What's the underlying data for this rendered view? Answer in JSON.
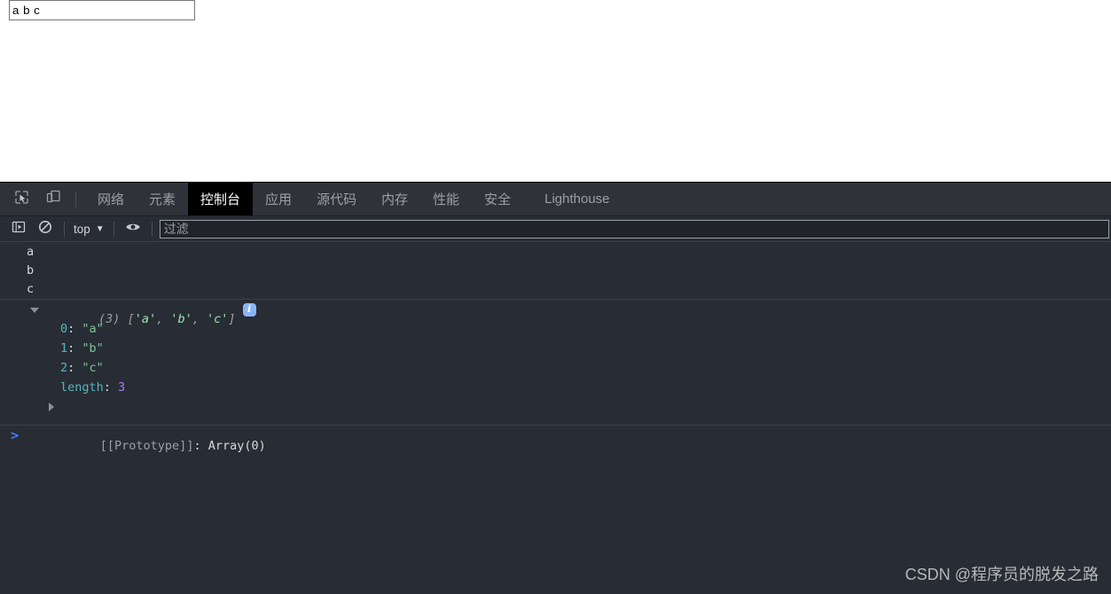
{
  "page": {
    "input_value": "a b c",
    "input_placeholder": ""
  },
  "devtools": {
    "toolbar": {
      "inspect_icon": "inspect-cursor-icon",
      "device_icon": "device-toolbar-icon"
    },
    "tabs": [
      {
        "id": "network",
        "label": "网络",
        "active": false
      },
      {
        "id": "elements",
        "label": "元素",
        "active": false
      },
      {
        "id": "console",
        "label": "控制台",
        "active": true
      },
      {
        "id": "application",
        "label": "应用",
        "active": false
      },
      {
        "id": "sources",
        "label": "源代码",
        "active": false
      },
      {
        "id": "memory",
        "label": "内存",
        "active": false
      },
      {
        "id": "performance",
        "label": "性能",
        "active": false
      },
      {
        "id": "security",
        "label": "安全",
        "active": false
      },
      {
        "id": "lighthouse",
        "label": "Lighthouse",
        "active": false
      }
    ],
    "console_toolbar": {
      "execute_icon": "execute-sidebar-icon",
      "clear_icon": "clear-console-icon",
      "context_label": "top",
      "context_caret": "▼",
      "eye_icon": "live-expression-eye-icon",
      "filter_placeholder": "过滤",
      "filter_value": ""
    },
    "console_output": {
      "log_lines": [
        "a",
        "b",
        "c"
      ],
      "array_entry": {
        "count_label": "(3)",
        "preview": "['a', 'b', 'c']",
        "preview_open": "[",
        "preview_items": [
          "'a'",
          "'b'",
          "'c'"
        ],
        "preview_close": "]",
        "separator": ", ",
        "info_badge": "i",
        "expanded": true,
        "properties": [
          {
            "key": "0",
            "value": "\"a\"",
            "type": "string"
          },
          {
            "key": "1",
            "value": "\"b\"",
            "type": "string"
          },
          {
            "key": "2",
            "value": "\"c\"",
            "type": "string"
          },
          {
            "key": "length",
            "value": "3",
            "type": "number"
          }
        ],
        "prototype": {
          "key": "[[Prototype]]",
          "value": "Array(0)"
        }
      }
    },
    "prompt": {
      "chevron": ">",
      "value": "",
      "placeholder": ""
    }
  },
  "watermark": {
    "text": "CSDN @程序员的脱发之路"
  },
  "colors": {
    "devtools_bg": "#282c34",
    "tabbar_bg": "#2f3238",
    "active_tab_bg": "#000000",
    "accent_blue": "#3b82f6",
    "info_badge": "#8ab4f8",
    "string_green": "#7ec699",
    "number_purple": "#a77bf3",
    "key_teal": "#56b6c2"
  }
}
